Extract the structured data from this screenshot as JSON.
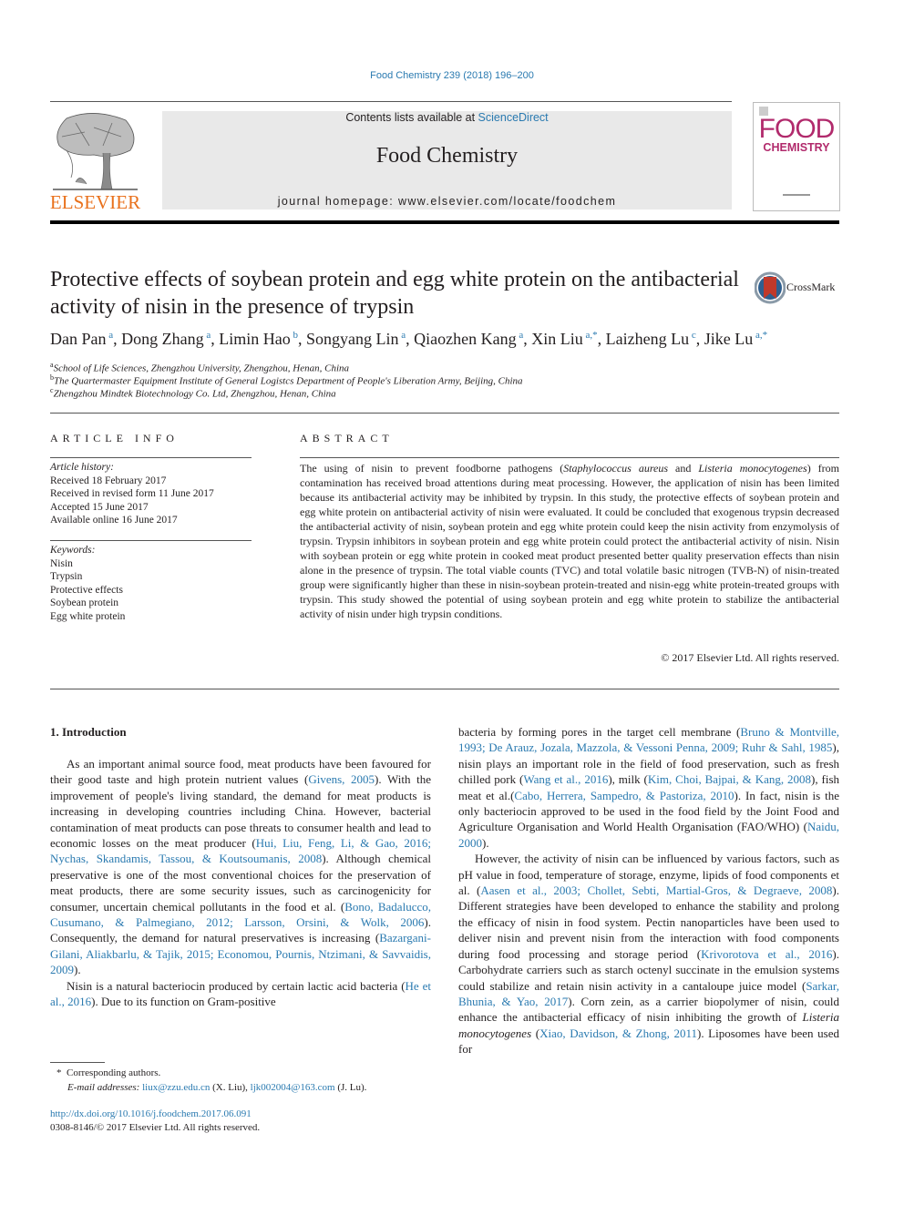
{
  "header": {
    "citation": "Food Chemistry 239 (2018) 196–200",
    "contents_prefix": "Contents lists available at ",
    "contents_link": "ScienceDirect",
    "journal_name": "Food Chemistry",
    "homepage": "journal homepage: www.elsevier.com/locate/foodchem",
    "publisher_logo_text": "ELSEVIER",
    "cover_title_line1": "FOOD",
    "cover_title_line2": "CHEMISTRY",
    "crossmark_label": "CrossMark"
  },
  "colors": {
    "link": "#2a7ab0",
    "elsevier_orange": "#e9711c",
    "cover_magenta": "#b12a6c",
    "banner_gray": "#e9e9e9",
    "crossmark_red": "#c0392b"
  },
  "article": {
    "title": "Protective effects of soybean protein and egg white protein on the antibacterial activity of nisin in the presence of trypsin",
    "authors": [
      {
        "name": "Dan Pan",
        "aff": "a"
      },
      {
        "name": "Dong Zhang",
        "aff": "a"
      },
      {
        "name": "Limin Hao",
        "aff": "b"
      },
      {
        "name": "Songyang Lin",
        "aff": "a"
      },
      {
        "name": "Qiaozhen Kang",
        "aff": "a"
      },
      {
        "name": "Xin Liu",
        "aff": "a,*"
      },
      {
        "name": "Laizheng Lu",
        "aff": "c"
      },
      {
        "name": "Jike Lu",
        "aff": "a,*"
      }
    ],
    "affiliations": [
      {
        "key": "a",
        "text": "School of Life Sciences, Zhengzhou University, Zhengzhou, Henan, China"
      },
      {
        "key": "b",
        "text": "The Quartermaster Equipment Institute of General Logistcs Department of People's Liberation Army, Beijing, China"
      },
      {
        "key": "c",
        "text": "Zhengzhou Mindtek Biotechnology Co. Ltd, Zhengzhou, Henan, China"
      }
    ]
  },
  "article_info": {
    "heading": "ARTICLE INFO",
    "history_label": "Article history:",
    "history": [
      "Received 18 February 2017",
      "Received in revised form 11 June 2017",
      "Accepted 15 June 2017",
      "Available online 16 June 2017"
    ],
    "keywords_label": "Keywords:",
    "keywords": [
      "Nisin",
      "Trypsin",
      "Protective effects",
      "Soybean protein",
      "Egg white protein"
    ]
  },
  "abstract": {
    "heading": "ABSTRACT",
    "parts": [
      {
        "t": "The using of nisin to prevent foodborne pathogens ("
      },
      {
        "t": "Staphylococcus aureus",
        "i": true
      },
      {
        "t": " and "
      },
      {
        "t": "Listeria monocytogenes",
        "i": true
      },
      {
        "t": ") from contamination has received broad attentions during meat processing. However, the application of nisin has been limited because its antibacterial activity may be inhibited by trypsin. In this study, the protective effects of soybean protein and egg white protein on antibacterial activity of nisin were evaluated. It could be concluded that exogenous trypsin decreased the antibacterial activity of nisin, soybean protein and egg white protein could keep the nisin activity from enzymolysis of trypsin. Trypsin inhibitors in soybean protein and egg white protein could protect the antibacterial activity of nisin. Nisin with soybean protein or egg white protein in cooked meat product presented better quality preservation effects than nisin alone in the presence of trypsin. The total viable counts (TVC) and total volatile basic nitrogen (TVB-N) of nisin-treated group were significantly higher than these in nisin-soybean protein-treated and nisin-egg white protein-treated groups with trypsin. This study showed the potential of using soybean protein and egg white protein to stabilize the antibacterial activity of nisin under high trypsin conditions."
      }
    ],
    "copyright": "© 2017 Elsevier Ltd. All rights reserved."
  },
  "body": {
    "section_heading": "1. Introduction",
    "left_paragraphs": [
      [
        {
          "t": "As an important animal source food, meat products have been favoured for their good taste and high protein nutrient values ("
        },
        {
          "t": "Givens, 2005",
          "link": true
        },
        {
          "t": "). With the improvement of people's living standard, the demand for meat products is increasing in developing countries including China. However, bacterial contamination of meat products can pose threats to consumer health and lead to economic losses on the meat producer ("
        },
        {
          "t": "Hui, Liu, Feng, Li, & Gao, 2016; Nychas, Skandamis, Tassou, & Koutsoumanis, 2008",
          "link": true
        },
        {
          "t": "). Although chemical preservative is one of the most conventional choices for the preservation of meat products, there are some security issues, such as carcinogenicity for consumer, uncertain chemical pollutants in the food et al. ("
        },
        {
          "t": "Bono, Badalucco, Cusumano, & Palmegiano, 2012; Larsson, Orsini, & Wolk, 2006",
          "link": true
        },
        {
          "t": "). Consequently, the demand for natural preservatives is increasing ("
        },
        {
          "t": "Bazargani-Gilani, Aliakbarlu, & Tajik, 2015; Economou, Pournis, Ntzimani, & Savvaidis, 2009",
          "link": true
        },
        {
          "t": ")."
        }
      ],
      [
        {
          "t": "Nisin is a natural bacteriocin produced by certain lactic acid bacteria ("
        },
        {
          "t": "He et al., 2016",
          "link": true
        },
        {
          "t": "). Due to its function on Gram-positive"
        }
      ]
    ],
    "right_paragraphs": [
      [
        {
          "t": "bacteria by forming pores in the target cell membrane ("
        },
        {
          "t": "Bruno & Montville, 1993; De Arauz, Jozala, Mazzola, & Vessoni Penna, 2009; Ruhr & Sahl, 1985",
          "link": true
        },
        {
          "t": "), nisin plays an important role in the field of food preservation, such as fresh chilled pork ("
        },
        {
          "t": "Wang et al., 2016",
          "link": true
        },
        {
          "t": "), milk ("
        },
        {
          "t": "Kim, Choi, Bajpai, & Kang, 2008",
          "link": true
        },
        {
          "t": "), fish meat et al.("
        },
        {
          "t": "Cabo, Herrera, Sampedro, & Pastoriza, 2010",
          "link": true
        },
        {
          "t": "). In fact, nisin is the only bacteriocin approved to be used in the food field by the Joint Food and Agriculture Organisation and World Health Organisation (FAO/WHO) ("
        },
        {
          "t": "Naidu, 2000",
          "link": true
        },
        {
          "t": ")."
        }
      ],
      [
        {
          "t": "However, the activity of nisin can be influenced by various factors, such as pH value in food, temperature of storage, enzyme, lipids of food components et al. ("
        },
        {
          "t": "Aasen et al., 2003; Chollet, Sebti, Martial-Gros, & Degraeve, 2008",
          "link": true
        },
        {
          "t": "). Different strategies have been developed to enhance the stability and prolong the efficacy of nisin in food system. Pectin nanoparticles have been used to deliver nisin and prevent nisin from the interaction with food components during food processing and storage period ("
        },
        {
          "t": "Krivorotova et al., 2016",
          "link": true
        },
        {
          "t": "). Carbohydrate carriers such as starch octenyl succinate in the emulsion systems could stabilize and retain nisin activity in a cantaloupe juice model ("
        },
        {
          "t": "Sarkar, Bhunia, & Yao, 2017",
          "link": true
        },
        {
          "t": "). Corn zein, as a carrier biopolymer of nisin, could enhance the antibacterial efficacy of nisin inhibiting the growth of "
        },
        {
          "t": "Listeria monocytogenes",
          "i": true
        },
        {
          "t": " ("
        },
        {
          "t": "Xiao, Davidson, & Zhong, 2011",
          "link": true
        },
        {
          "t": "). Liposomes have been used for"
        }
      ]
    ]
  },
  "footnotes": {
    "star": "*",
    "corresponding": "Corresponding authors.",
    "email_label": "E-mail addresses:",
    "email1": "liux@zzu.edu.cn",
    "email1_who": " (X. Liu), ",
    "email2": "ljk002004@163.com",
    "email2_who": " (J. Lu).",
    "doi": "http://dx.doi.org/10.1016/j.foodchem.2017.06.091",
    "issn": "0308-8146/© 2017 Elsevier Ltd. All rights reserved."
  }
}
